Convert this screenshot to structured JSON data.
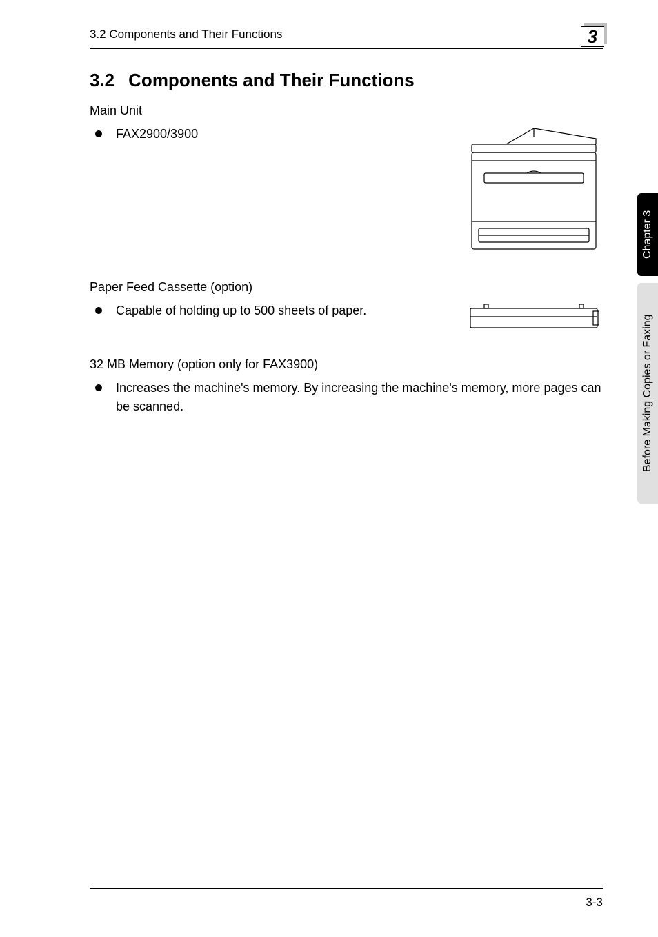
{
  "header": {
    "running_head": "3.2 Components and Their Functions",
    "chapter_number": "3"
  },
  "section": {
    "number": "3.2",
    "title": "Components and Their Functions"
  },
  "blocks": {
    "main_unit": {
      "label": "Main Unit",
      "bullet": "FAX2900/3900"
    },
    "paper_cassette": {
      "label": "Paper Feed Cassette (option)",
      "bullet": "Capable of holding up to 500 sheets of paper."
    },
    "memory": {
      "label": "32 MB Memory (option only for FAX3900)",
      "bullet": "Increases the machine's memory. By increasing the machine's memory, more pages can be scanned."
    }
  },
  "sidebar": {
    "chapter": "Chapter 3",
    "section_name": "Before Making Copies or Faxing"
  },
  "footer": {
    "page": "3-3"
  }
}
